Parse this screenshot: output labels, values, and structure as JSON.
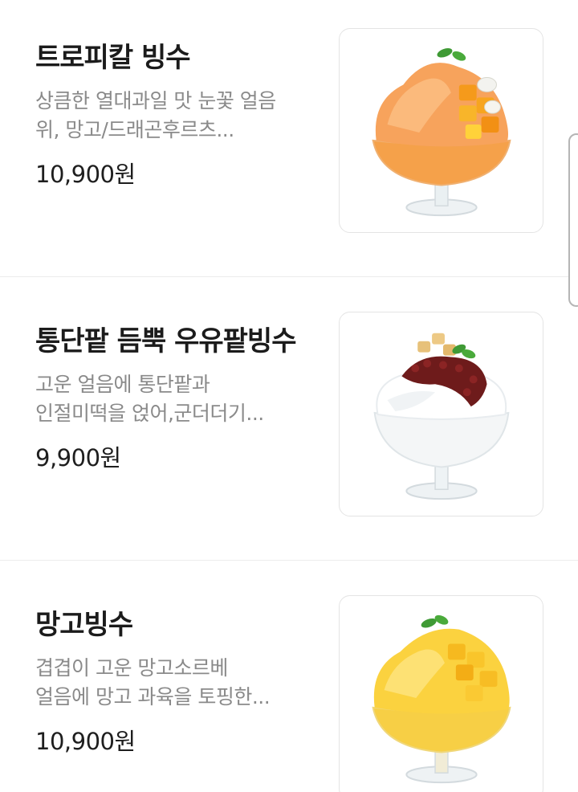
{
  "menu": {
    "items": [
      {
        "name": "트로피칼 빙수",
        "desc_line1": "상큼한 열대과일 맛 눈꽃 얼음",
        "desc_line2": "위, 망고/드래곤후르츠...",
        "price": "10,900원",
        "image": "tropical-bingsu-photo"
      },
      {
        "name": "통단팥 듬뿍 우유팥빙수",
        "desc_line1": "고운 얼음에 통단팥과",
        "desc_line2": "인절미떡을 얹어,군더더기...",
        "price": "9,900원",
        "image": "red-bean-bingsu-photo"
      },
      {
        "name": "망고빙수",
        "desc_line1": "겹겹이 고운 망고소르베",
        "desc_line2": "얼음에 망고 과육을 토핑한...",
        "price": "10,900원",
        "image": "mango-bingsu-photo"
      }
    ]
  },
  "colors": {
    "divider": "#ececec",
    "desc_text": "#8a8a8a",
    "title_text": "#1b1b1b"
  }
}
